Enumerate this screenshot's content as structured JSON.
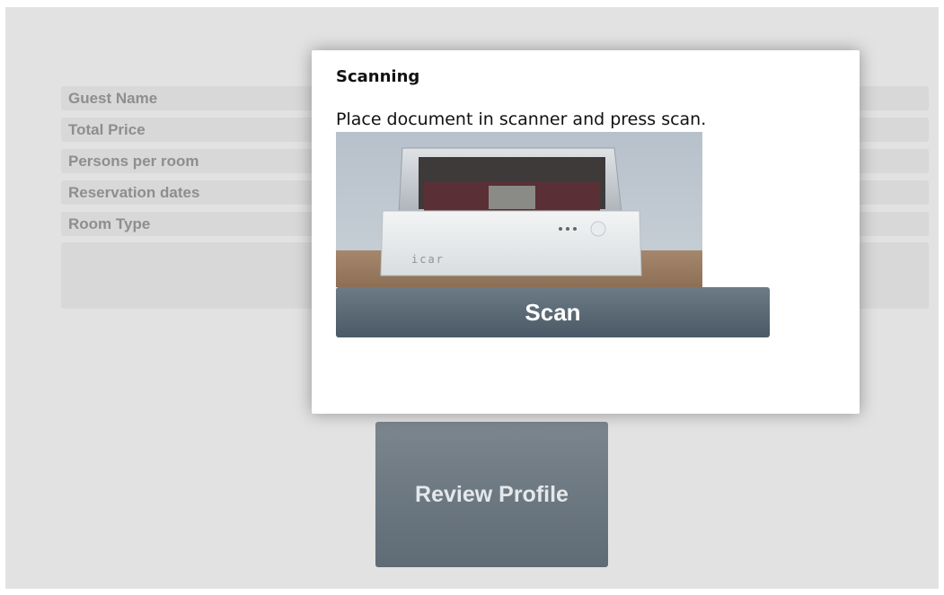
{
  "reservation": {
    "rows": [
      {
        "label": "Guest Name"
      },
      {
        "label": "Total Price"
      },
      {
        "label": "Persons per room"
      },
      {
        "label": "Reservation dates"
      },
      {
        "label": "Room Type"
      }
    ]
  },
  "actions": {
    "review_profile_label": "Review Profile"
  },
  "modal": {
    "title": "Scanning",
    "instruction": "Place document in scanner and press scan.",
    "scanner_brand": "icar",
    "scan_label": "Scan"
  },
  "colors": {
    "page_background": "#e2e2e2",
    "button_top": "#7b868e",
    "button_bottom": "#5f6b75",
    "scan_button_bottom": "#4b5966"
  }
}
